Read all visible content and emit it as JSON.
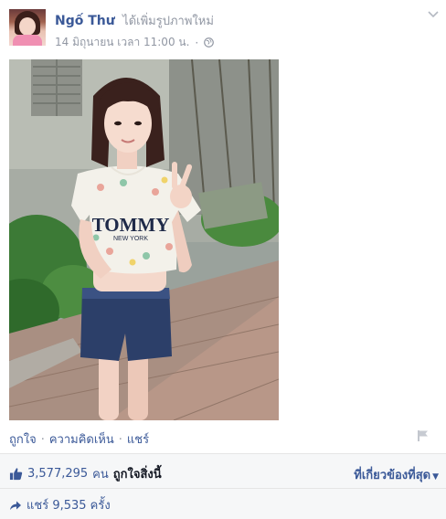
{
  "post": {
    "author_name": "Ngố Thư",
    "action_text": "ได้เพิ่มรูปภาพใหม่",
    "timestamp": "14 มิถุนายน เวลา 11:00 น.",
    "separator": "·",
    "privacy_icon": "globe-icon",
    "menu_icon": "chevron-down-icon"
  },
  "photo": {
    "shirt_text": "TOMMY",
    "shirt_subtext": "NEW YORK"
  },
  "actions": {
    "like_label": "ถูกใจ",
    "comment_label": "ความคิดเห็น",
    "share_label": "แชร์",
    "dot": "·",
    "flag_icon": "flag-icon"
  },
  "feedback": {
    "likes_count": "3,577,295",
    "likes_unit": "คน",
    "likes_text": "ถูกใจสิ่งนี้",
    "sort_label": "ที่เกี่ยวข้องที่สุด",
    "shares_text": "แชร์ 9,535 ครั้ง"
  },
  "colors": {
    "link": "#3b5998",
    "muted": "#9197a3",
    "feedback_bg": "#f6f7f8"
  }
}
